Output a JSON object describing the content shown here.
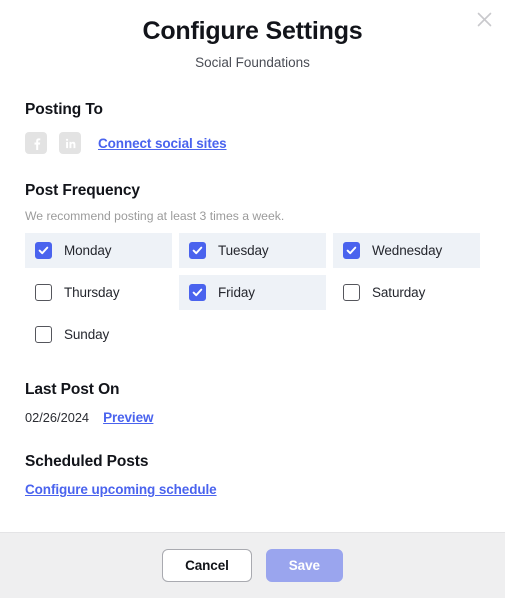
{
  "dialog": {
    "title": "Configure Settings",
    "subtitle": "Social Foundations",
    "close_icon": "close-icon"
  },
  "posting_to": {
    "heading": "Posting To",
    "accounts": [
      {
        "icon": "facebook-icon",
        "connected": false
      },
      {
        "icon": "linkedin-icon",
        "connected": false
      }
    ],
    "connect_link": "Connect social sites"
  },
  "post_frequency": {
    "heading": "Post Frequency",
    "note": "We recommend posting at least 3 times a week.",
    "days": [
      {
        "label": "Monday",
        "checked": true
      },
      {
        "label": "Tuesday",
        "checked": true
      },
      {
        "label": "Wednesday",
        "checked": true
      },
      {
        "label": "Thursday",
        "checked": false
      },
      {
        "label": "Friday",
        "checked": true
      },
      {
        "label": "Saturday",
        "checked": false
      },
      {
        "label": "Sunday",
        "checked": false
      }
    ]
  },
  "last_post_on": {
    "heading": "Last Post On",
    "date": "02/26/2024",
    "preview_link": "Preview"
  },
  "scheduled_posts": {
    "heading": "Scheduled Posts",
    "configure_link": "Configure upcoming schedule"
  },
  "footer": {
    "cancel_label": "Cancel",
    "save_label": "Save",
    "save_enabled": false
  },
  "colors": {
    "accent": "#4a63ee",
    "link": "#4a63ee",
    "save_disabled": "#9aa5ee",
    "selected_cell": "#eef2f7",
    "footer_bg": "#efeff0",
    "social_disabled": "#e3e3e3"
  }
}
